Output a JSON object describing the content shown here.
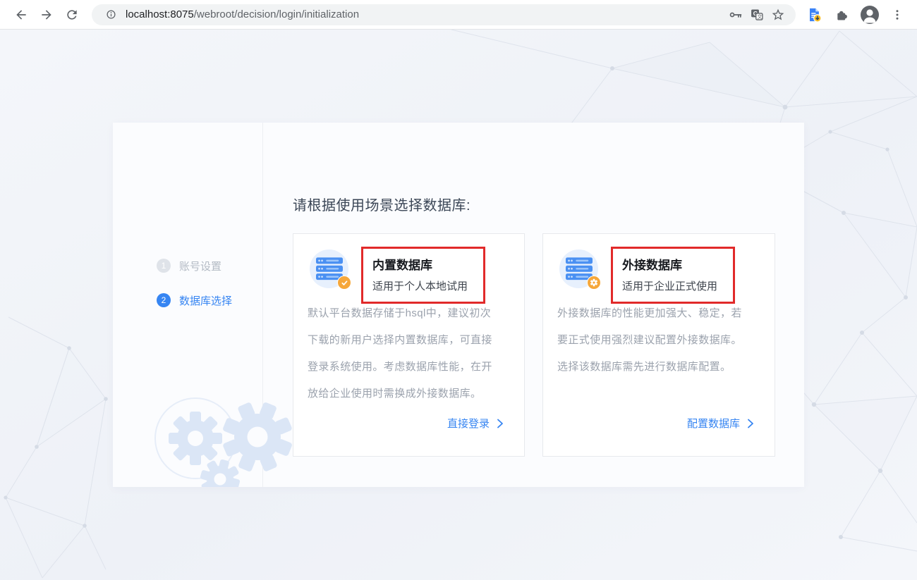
{
  "browser": {
    "address": {
      "host": "localhost:8075",
      "path": "/webroot/decision/login/initialization"
    },
    "icons": {
      "back": "arrow-left-icon",
      "forward": "arrow-right-icon",
      "reload": "reload-icon",
      "page_info": "info-circle-icon",
      "password_key": "key-icon",
      "translate": "translate-icon",
      "bookmark": "star-outline-icon",
      "download_extension": "document-download-icon",
      "extensions": "puzzle-piece-icon",
      "profile": "avatar-icon",
      "menu": "kebab-menu-icon"
    }
  },
  "wizard": {
    "steps": [
      {
        "number": "1",
        "label": "账号设置",
        "active": false
      },
      {
        "number": "2",
        "label": "数据库选择",
        "active": true
      }
    ],
    "title": "请根据使用场景选择数据库:",
    "cards": [
      {
        "title": "内置数据库",
        "subtitle": "适用于个人本地试用",
        "badge_icon": "check-circle-icon",
        "description_lines": [
          "默认平台数据存储于hsql中，建议初次",
          "下载的新用户选择内置数据库，可直接",
          "登录系统使用。考虑数据库性能，在开",
          "放给企业使用时需换成外接数据库。"
        ],
        "action": "直接登录"
      },
      {
        "title": "外接数据库",
        "subtitle": "适用于企业正式使用",
        "badge_icon": "gear-circle-icon",
        "description_lines": [
          "外接数据库的性能更加强大、稳定，若",
          "要正式使用强烈建议配置外接数据库。",
          "选择该数据库需先进行数据库配置。"
        ],
        "action": "配置数据库"
      }
    ]
  },
  "colors": {
    "accent": "#3685f2",
    "link_blue": "#3685f2",
    "highlight_red": "#e12a2a",
    "badge_orange": "#f6a73a",
    "icon_blue": "#4a90f2",
    "icon_circle_bg": "#e7f0fd",
    "step_inactive": "#dfe3e9",
    "toolbar_bg": "#ffffff",
    "panel_bg": "#fbfcfe"
  }
}
